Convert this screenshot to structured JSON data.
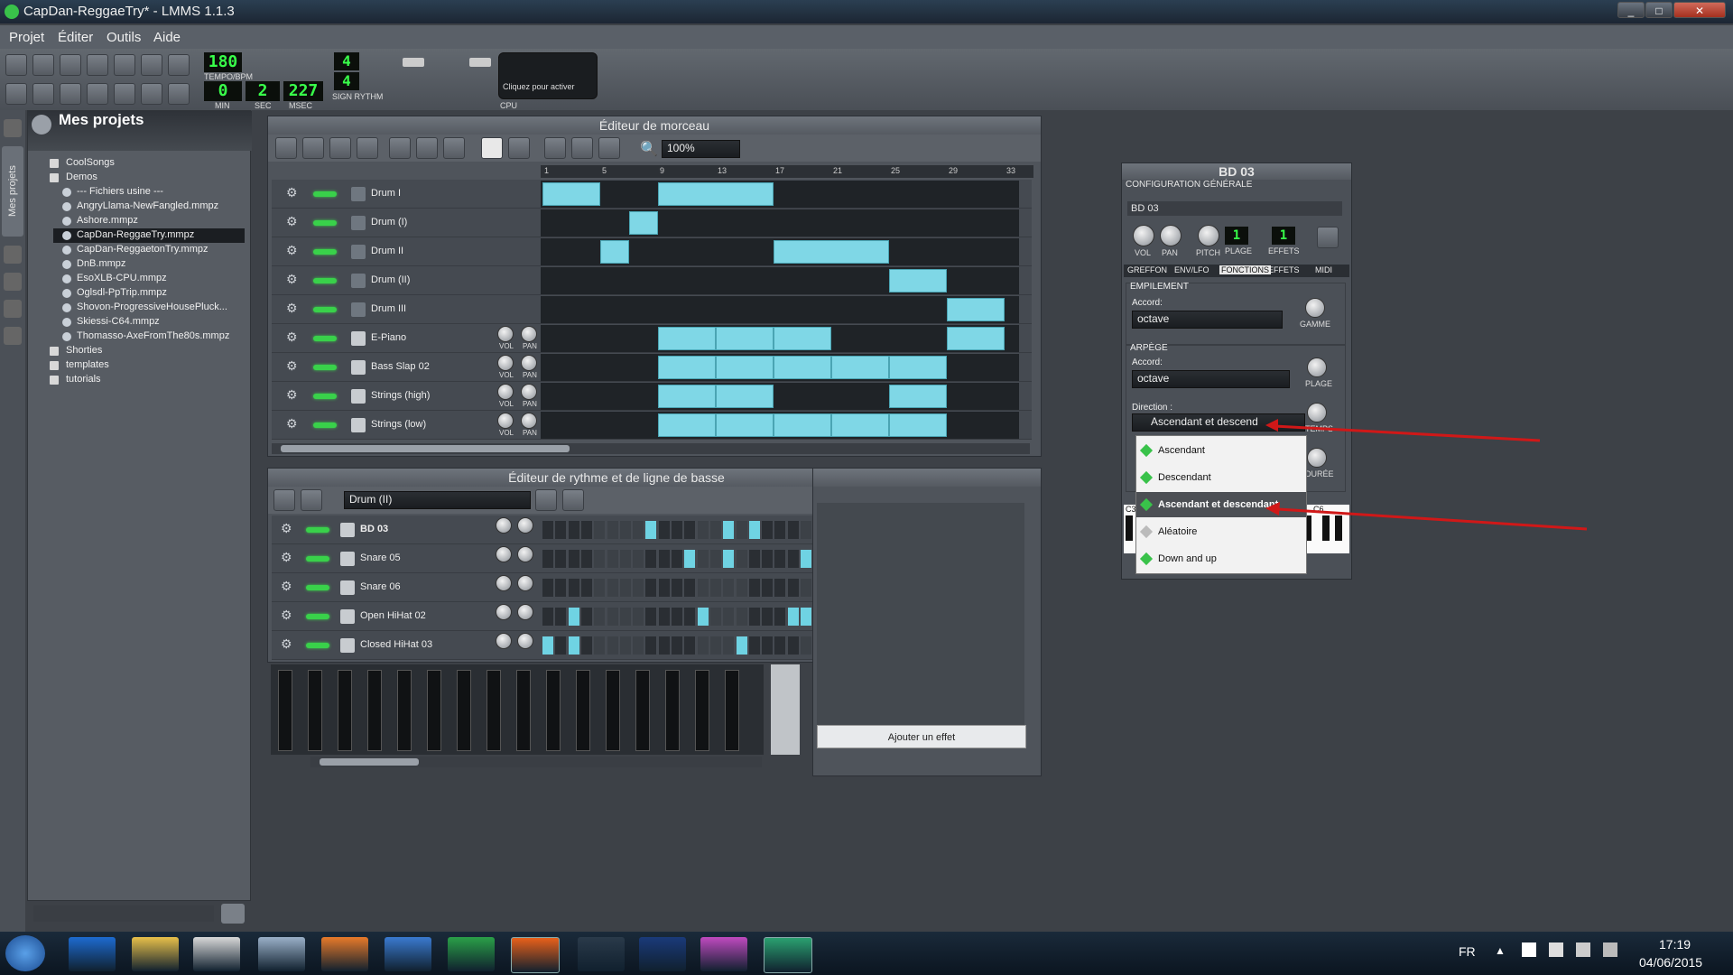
{
  "window": {
    "title": "CapDan-ReggaeTry* - LMMS 1.1.3",
    "controls": [
      "_",
      "□",
      "✕"
    ]
  },
  "menu": [
    "Projet",
    "Éditer",
    "Outils",
    "Aide"
  ],
  "toolbar": {
    "tempo": "180",
    "tempo_label": "TEMPO/BPM",
    "min": "0",
    "min_label": "MIN",
    "sec": "2",
    "sec_label": "SEC",
    "msec": "227",
    "msec_label": "MSEC",
    "sig_top": "4",
    "sig_bottom": "4",
    "sig_label": "SIGN RYTHM",
    "cpu_hint": "Cliquez pour activer",
    "cpu_label": "CPU"
  },
  "sidebar": {
    "vertical_label": "Mes projets"
  },
  "file_panel": {
    "title": "Mes projets",
    "items": [
      {
        "label": "CoolSongs",
        "level": 0
      },
      {
        "label": "Demos",
        "level": 0
      },
      {
        "label": "--- Fichiers usine ---",
        "level": 1
      },
      {
        "label": "AngryLlama-NewFangled.mmpz",
        "level": 1
      },
      {
        "label": "Ashore.mmpz",
        "level": 1
      },
      {
        "label": "CapDan-ReggaeTry.mmpz",
        "level": 1,
        "selected": true
      },
      {
        "label": "CapDan-ReggaetonTry.mmpz",
        "level": 1
      },
      {
        "label": "DnB.mmpz",
        "level": 1
      },
      {
        "label": "EsoXLB-CPU.mmpz",
        "level": 1
      },
      {
        "label": "Oglsdl-PpTrip.mmpz",
        "level": 1
      },
      {
        "label": "Shovon-ProgressiveHousePluck...",
        "level": 1
      },
      {
        "label": "Skiessi-C64.mmpz",
        "level": 1
      },
      {
        "label": "Thomasso-AxeFromThe80s.mmpz",
        "level": 1
      },
      {
        "label": "Shorties",
        "level": 0
      },
      {
        "label": "templates",
        "level": 0
      },
      {
        "label": "tutorials",
        "level": 0
      }
    ]
  },
  "song_editor": {
    "title": "Éditeur de morceau",
    "zoom": "100%",
    "ruler": [
      "1",
      "5",
      "9",
      "13",
      "17",
      "21",
      "25",
      "29",
      "33"
    ],
    "tracks": [
      {
        "name": "Drum I",
        "type": "beat"
      },
      {
        "name": "Drum (I)",
        "type": "beat"
      },
      {
        "name": "Drum II",
        "type": "beat"
      },
      {
        "name": "Drum (II)",
        "type": "beat"
      },
      {
        "name": "Drum III",
        "type": "beat"
      },
      {
        "name": "E-Piano",
        "type": "inst"
      },
      {
        "name": "Bass Slap 02",
        "type": "inst"
      },
      {
        "name": "Strings (high)",
        "type": "inst"
      },
      {
        "name": "Strings (low)",
        "type": "inst"
      }
    ],
    "vol_label": "VOL",
    "pan_label": "PAN"
  },
  "beat_editor": {
    "title": "Éditeur de rythme et de ligne de basse",
    "pattern": "Drum (II)",
    "tracks": [
      {
        "name": "BD 03",
        "steps": [
          0,
          0,
          0,
          0,
          0,
          0,
          0,
          0,
          1,
          0,
          0,
          0,
          0,
          0,
          1,
          0,
          1,
          0,
          0,
          0,
          0,
          0,
          0,
          0,
          1,
          0,
          0,
          0,
          0,
          0,
          0,
          0
        ]
      },
      {
        "name": "Snare 05",
        "steps": [
          0,
          0,
          0,
          0,
          0,
          0,
          0,
          0,
          0,
          0,
          0,
          1,
          0,
          0,
          1,
          0,
          0,
          0,
          0,
          0,
          1,
          0,
          0,
          0,
          0,
          0,
          0,
          0,
          0,
          0,
          1,
          0
        ]
      },
      {
        "name": "Snare 06",
        "steps": [
          0,
          0,
          0,
          0,
          0,
          0,
          0,
          0,
          0,
          0,
          0,
          0,
          0,
          0,
          0,
          0,
          0,
          0,
          0,
          0,
          0,
          0,
          0,
          0,
          0,
          0,
          0,
          0,
          0,
          0,
          0,
          0
        ]
      },
      {
        "name": "Open HiHat 02",
        "steps": [
          0,
          0,
          1,
          0,
          0,
          0,
          0,
          0,
          0,
          0,
          0,
          0,
          1,
          0,
          0,
          0,
          0,
          0,
          0,
          1,
          1,
          0,
          0,
          0,
          0,
          0,
          0,
          0,
          1,
          0,
          0,
          0
        ]
      },
      {
        "name": "Closed HiHat 03",
        "steps": [
          1,
          0,
          1,
          0,
          0,
          0,
          0,
          0,
          0,
          0,
          0,
          0,
          0,
          0,
          0,
          1,
          0,
          0,
          0,
          0,
          0,
          1,
          1,
          0,
          0,
          0,
          1,
          0,
          0,
          0,
          0,
          0
        ]
      }
    ]
  },
  "fx_panel": {
    "add_effect": "Ajouter un effet"
  },
  "plugin": {
    "title": "BD 03",
    "section": "CONFIGURATION GÉNÉRALE",
    "name": "BD 03",
    "knobs": [
      "VOL",
      "PAN",
      "PITCH",
      "PLAGE"
    ],
    "effects_label": "EFFETS",
    "plage_lcd": "1",
    "effets_lcd": "1",
    "tabs": [
      "GREFFON",
      "ENV/LFO",
      "FONCTIONS",
      "EFFETS",
      "MIDI"
    ],
    "stacking": {
      "title": "EMPILEMENT",
      "chord_label": "Accord:",
      "chord": "octave",
      "knob": "GAMME"
    },
    "arp": {
      "title": "ARPÈGE",
      "chord_label": "Accord:",
      "chord": "octave",
      "knob1": "PLAGE",
      "direction_label": "Direction :",
      "direction": "Ascendant et descend",
      "knob2": "TEMPS",
      "knob3": "DURÉE",
      "options": [
        "Ascendant",
        "Descendant",
        "Ascendant et descendant",
        "Aléatoire",
        "Down and up"
      ],
      "selected": 2
    },
    "piano_c3": "C3",
    "piano_c6": "C6"
  },
  "taskbar": {
    "lang": "FR",
    "time": "17:19",
    "date": "04/06/2015",
    "apps": [
      "start",
      "ie",
      "explorer",
      "7z",
      "notepad",
      "media",
      "thunderbird",
      "chrome",
      "firefox",
      "eos",
      "ps",
      "color",
      "lmms"
    ]
  },
  "colors": {
    "clip": "#7fd7e6",
    "led": "#39d14a",
    "lcd": "#38ff4a",
    "arrow": "#d01818"
  }
}
